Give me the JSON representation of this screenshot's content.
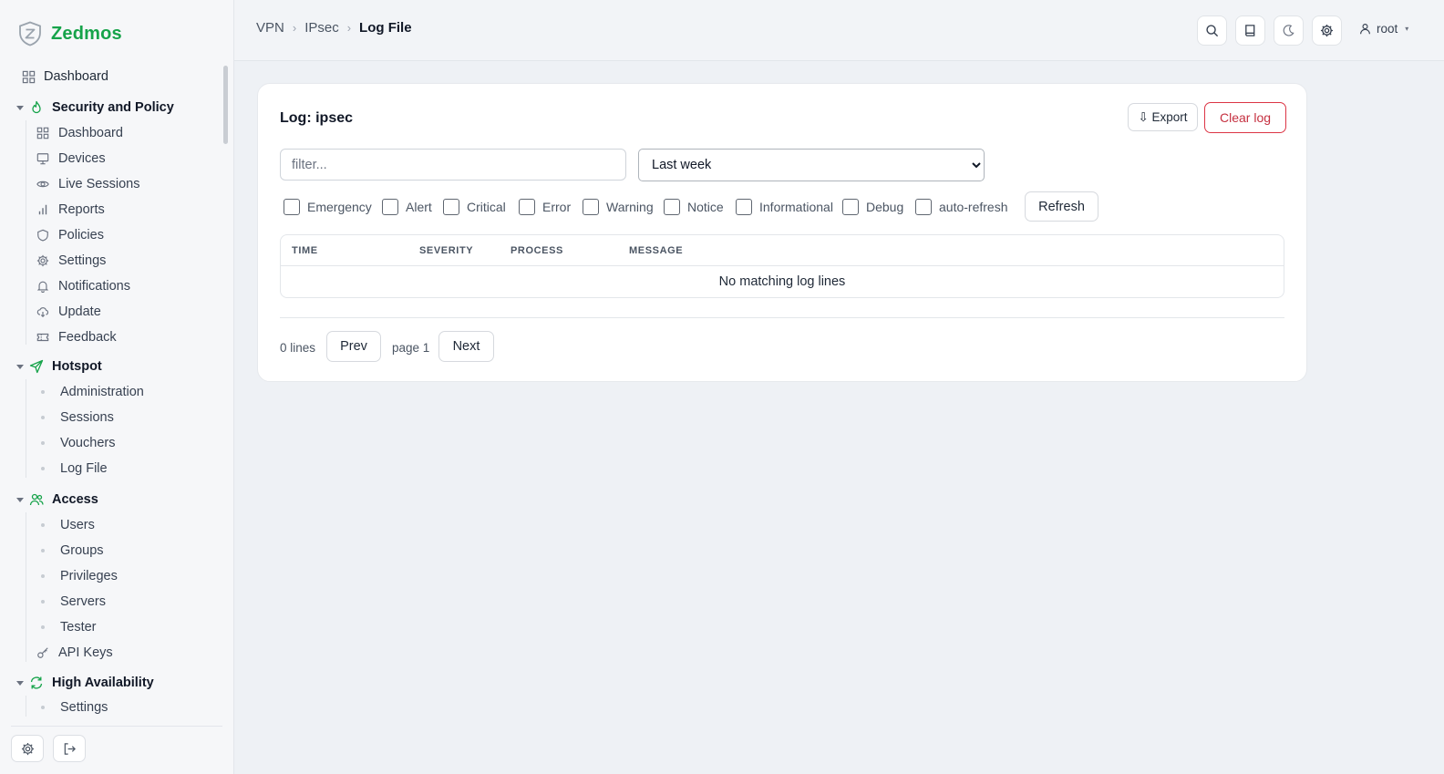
{
  "brand": {
    "name": "Zedmos"
  },
  "sidebar": {
    "top_item": {
      "label": "Dashboard",
      "icon": "grid-icon"
    },
    "groups": [
      {
        "label": "Security and Policy",
        "icon": "flame-icon",
        "items": [
          {
            "label": "Dashboard",
            "icon": "grid-icon"
          },
          {
            "label": "Devices",
            "icon": "monitor-icon"
          },
          {
            "label": "Live Sessions",
            "icon": "eye-icon"
          },
          {
            "label": "Reports",
            "icon": "bar-chart-icon"
          },
          {
            "label": "Policies",
            "icon": "shield-icon"
          },
          {
            "label": "Settings",
            "icon": "gear-icon"
          },
          {
            "label": "Notifications",
            "icon": "bell-icon"
          },
          {
            "label": "Update",
            "icon": "cloud-download-icon"
          },
          {
            "label": "Feedback",
            "icon": "ticket-icon"
          }
        ]
      },
      {
        "label": "Hotspot",
        "icon": "send-icon",
        "items": [
          {
            "label": "Administration"
          },
          {
            "label": "Sessions"
          },
          {
            "label": "Vouchers"
          },
          {
            "label": "Log File"
          }
        ]
      },
      {
        "label": "Access",
        "icon": "users-icon",
        "items": [
          {
            "label": "Users"
          },
          {
            "label": "Groups"
          },
          {
            "label": "Privileges"
          },
          {
            "label": "Servers"
          },
          {
            "label": "Tester"
          },
          {
            "label": "API Keys",
            "icon": "key-icon"
          }
        ]
      },
      {
        "label": "High Availability",
        "icon": "refresh-icon",
        "items": [
          {
            "label": "Settings"
          }
        ]
      }
    ]
  },
  "breadcrumb": {
    "items": [
      "VPN",
      "IPsec"
    ],
    "current": "Log File"
  },
  "header": {
    "user": "root"
  },
  "log": {
    "title": "Log: ipsec",
    "export_label": "⇩ Export",
    "clear_label": "Clear log",
    "filter_placeholder": "filter...",
    "range_selected": "Last week",
    "severities": [
      "Emergency",
      "Alert",
      "Critical",
      "Error",
      "Warning",
      "Notice",
      "Informational",
      "Debug"
    ],
    "auto_refresh_label": "auto-refresh",
    "refresh_label": "Refresh",
    "columns": [
      "TIME",
      "SEVERITY",
      "PROCESS",
      "MESSAGE"
    ],
    "empty_message": "No matching log lines",
    "line_count": "0 lines",
    "prev_label": "Prev",
    "page_label": "page 1",
    "next_label": "Next"
  },
  "colors": {
    "accent": "#16a34a",
    "danger": "#dc3545"
  }
}
